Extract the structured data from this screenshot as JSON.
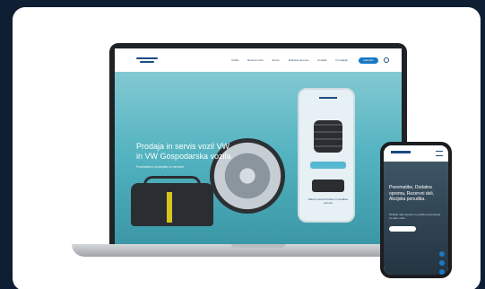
{
  "laptop": {
    "nav_items": [
      "Vozila",
      "Rezervni deli",
      "Servis",
      "Dodatna oprema",
      "Kontakt",
      "O podjetju"
    ],
    "cta_label": "Naročilo",
    "hero_title": "Prodaja in servis vozil VW in VW Gospodarska vozila",
    "hero_subtitle": "Pooblaščeni prodajalec in serviser",
    "showcase_caption": "Nakup rezervnih delov in dodatne opreme"
  },
  "phone": {
    "hero_title": "Pnevmatike, Dodatna oprema, Rezervni deli, Akcijska ponudba.",
    "hero_subtitle": "Obiščite našo trgovino in poiščite pravi izdelek za vaše vozilo."
  },
  "colors": {
    "page_bg": "#0f1f33",
    "card_bg": "#ffffff",
    "brand_blue": "#1a78c2",
    "hero_teal": "#53b3c0"
  }
}
